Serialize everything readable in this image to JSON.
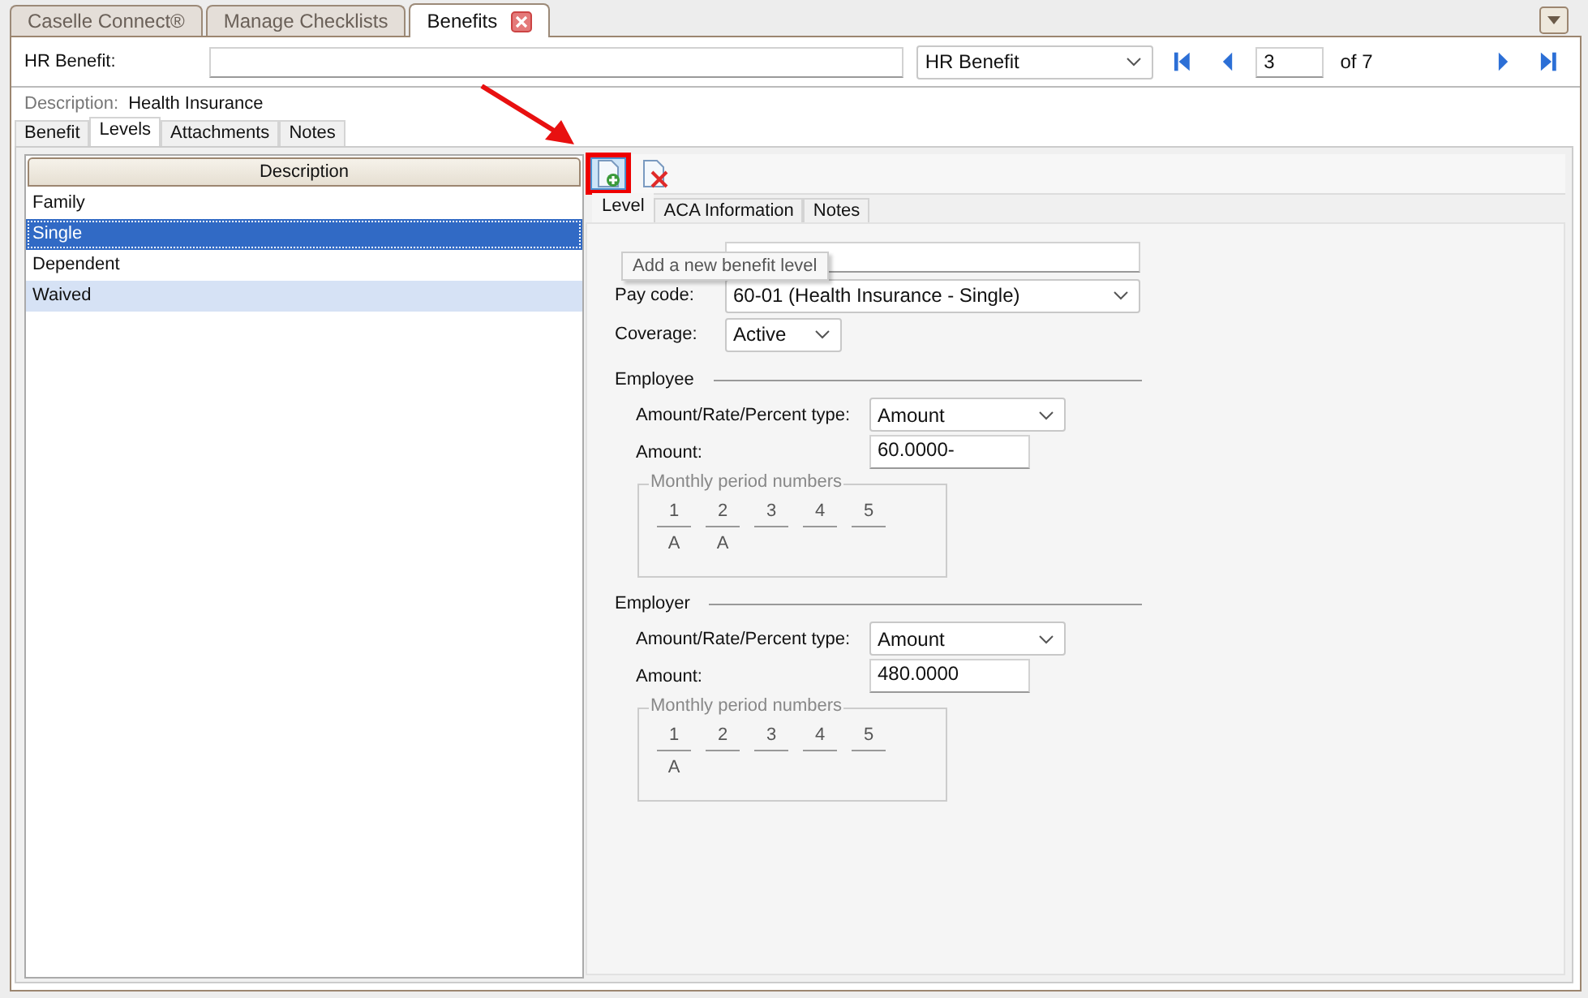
{
  "doc_tabs": [
    {
      "label": "Caselle Connect®",
      "selected": false,
      "closable": false
    },
    {
      "label": "Manage Checklists",
      "selected": false,
      "closable": false
    },
    {
      "label": "Benefits",
      "selected": true,
      "closable": true
    }
  ],
  "header": {
    "label": "HR Benefit:",
    "type_select": "HR Benefit",
    "record": "3",
    "record_total": "of 7"
  },
  "description": {
    "label": "Description:",
    "value": "Health Insurance"
  },
  "tabs": [
    {
      "label": "Benefit",
      "selected": false
    },
    {
      "label": "Levels",
      "selected": true
    },
    {
      "label": "Attachments",
      "selected": false
    },
    {
      "label": "Notes",
      "selected": false
    }
  ],
  "levels": {
    "column": "Description",
    "rows": [
      {
        "label": "Family",
        "selected": false,
        "hovered": false
      },
      {
        "label": "Single",
        "selected": true,
        "hovered": false
      },
      {
        "label": "Dependent",
        "selected": false,
        "hovered": false
      },
      {
        "label": "Waived",
        "selected": false,
        "hovered": true
      }
    ]
  },
  "detail_tabs": [
    {
      "label": "Level",
      "selected": true
    },
    {
      "label": "ACA Information",
      "selected": false
    },
    {
      "label": "Notes",
      "selected": false
    }
  ],
  "tooltip": "Add a new benefit level",
  "pay_code": {
    "label": "Pay code:",
    "value": "60-01 (Health Insurance - Single)"
  },
  "coverage": {
    "label": "Coverage:",
    "value": "Active"
  },
  "sections": [
    {
      "title": "Employee",
      "type_label": "Amount/Rate/Percent type:",
      "type_value": "Amount",
      "amount_label": "Amount:",
      "amount": "60.0000-",
      "periods_title": "Monthly period numbers",
      "periods": [
        {
          "number": "1",
          "value": "A"
        },
        {
          "number": "2",
          "value": "A"
        },
        {
          "number": "3"
        },
        {
          "number": "4"
        },
        {
          "number": "5"
        }
      ]
    },
    {
      "title": "Employer",
      "type_label": "Amount/Rate/Percent type:",
      "type_value": "Amount",
      "amount_label": "Amount:",
      "amount": "480.0000",
      "periods_title": "Monthly period numbers",
      "periods": [
        {
          "number": "1",
          "value": "A"
        },
        {
          "number": "2"
        },
        {
          "number": "3"
        },
        {
          "number": "4"
        },
        {
          "number": "5"
        }
      ]
    }
  ]
}
